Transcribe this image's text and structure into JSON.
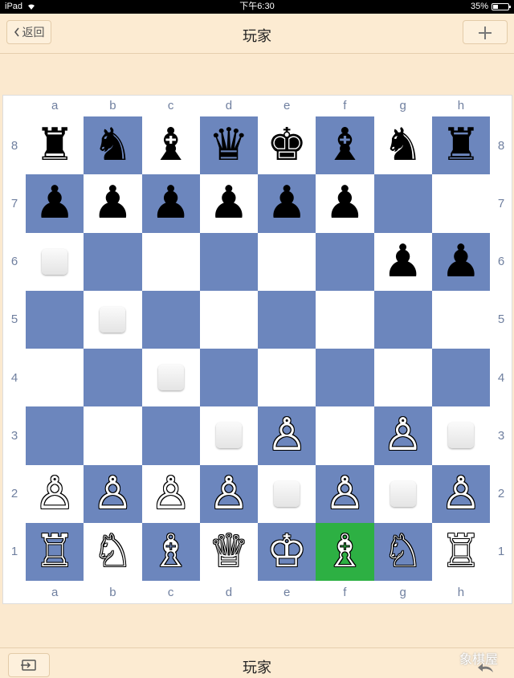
{
  "status_bar": {
    "device": "iPad",
    "time": "下午6:30",
    "battery": "35%",
    "battery_level": 0.35
  },
  "header": {
    "back_label": "返回",
    "title": "玩家"
  },
  "board": {
    "files": [
      "a",
      "b",
      "c",
      "d",
      "e",
      "f",
      "g",
      "h"
    ],
    "ranks": [
      "8",
      "7",
      "6",
      "5",
      "4",
      "3",
      "2",
      "1"
    ],
    "squares": [
      [
        "♜",
        "♞",
        "♝",
        "♛",
        "♚",
        "♝",
        "♞",
        "♜"
      ],
      [
        "♟",
        "♟",
        "♟",
        "♟",
        "♟",
        "♟",
        "",
        ""
      ],
      [
        "",
        "",
        "",
        "",
        "",
        "",
        "♟",
        "♟"
      ],
      [
        "",
        "",
        "",
        "",
        "",
        "",
        "",
        ""
      ],
      [
        "",
        "",
        "",
        "",
        "",
        "",
        "",
        ""
      ],
      [
        "",
        "",
        "",
        "",
        "♙",
        "",
        "♙",
        ""
      ],
      [
        "♙",
        "♙",
        "♙",
        "♙",
        "",
        "♙",
        "",
        "♙"
      ],
      [
        "♖",
        "♘",
        "♗",
        "♕",
        "♔",
        "♗",
        "♘",
        "♖"
      ]
    ],
    "markers": [
      "a6",
      "b5",
      "c4",
      "d3",
      "h3",
      "e2",
      "g2"
    ],
    "highlight": "f1",
    "highlight_color": "#2db043",
    "light_color": "#ffffff",
    "dark_color": "#6c86bd"
  },
  "footer": {
    "title": "玩家",
    "watermark": "象棋屋"
  }
}
